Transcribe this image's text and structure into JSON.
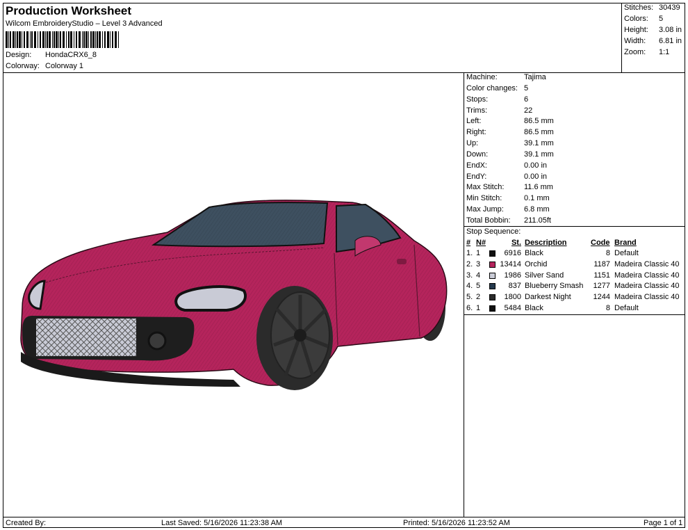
{
  "header": {
    "title": "Production Worksheet",
    "subtitle": "Wilcom EmbroideryStudio – Level 3 Advanced",
    "design_label": "Design:",
    "design_value": "HondaCRX6_8",
    "colorway_label": "Colorway:",
    "colorway_value": "Colorway 1"
  },
  "stats": [
    {
      "label": "Stitches:",
      "value": "30439"
    },
    {
      "label": "Colors:",
      "value": "5"
    },
    {
      "label": "Height:",
      "value": "3.08 in"
    },
    {
      "label": "Width:",
      "value": "6.81 in"
    },
    {
      "label": "Zoom:",
      "value": "1:1"
    }
  ],
  "machine_info": [
    {
      "label": "Machine:",
      "value": "Tajima"
    },
    {
      "label": "Color changes:",
      "value": "5"
    },
    {
      "label": "Stops:",
      "value": "6"
    },
    {
      "label": "Trims:",
      "value": "22"
    },
    {
      "label": "Left:",
      "value": "86.5 mm"
    },
    {
      "label": "Right:",
      "value": "86.5 mm"
    },
    {
      "label": "Up:",
      "value": "39.1 mm"
    },
    {
      "label": "Down:",
      "value": "39.1 mm"
    },
    {
      "label": "EndX:",
      "value": "0.00 in"
    },
    {
      "label": "EndY:",
      "value": "0.00 in"
    },
    {
      "label": "Max Stitch:",
      "value": "11.6 mm"
    },
    {
      "label": "Min Stitch:",
      "value": "0.1 mm"
    },
    {
      "label": "Max Jump:",
      "value": "6.8 mm"
    },
    {
      "label": "Total Bobbin:",
      "value": "211.05ft"
    }
  ],
  "stop_sequence": {
    "title": "Stop Sequence:",
    "headers": {
      "num": "#",
      "n": "N#",
      "st": "St.",
      "description": "Description",
      "code": "Code",
      "brand": "Brand"
    },
    "rows": [
      {
        "num": "1.",
        "n": "1",
        "color": "#111111",
        "st": "6916",
        "description": "Black",
        "code": "8",
        "brand": "Default"
      },
      {
        "num": "2.",
        "n": "3",
        "color": "#b5245c",
        "st": "13414",
        "description": "Orchid",
        "code": "1187",
        "brand": "Madeira Classic 40"
      },
      {
        "num": "3.",
        "n": "4",
        "color": "#c9cbd6",
        "st": "1986",
        "description": "Silver Sand",
        "code": "1151",
        "brand": "Madeira Classic 40"
      },
      {
        "num": "4.",
        "n": "5",
        "color": "#253a4e",
        "st": "837",
        "description": "Blueberry Smash",
        "code": "1277",
        "brand": "Madeira Classic 40"
      },
      {
        "num": "5.",
        "n": "2",
        "color": "#2b2b2b",
        "st": "1800",
        "description": "Darkest Night",
        "code": "1244",
        "brand": "Madeira Classic 40"
      },
      {
        "num": "6.",
        "n": "1",
        "color": "#111111",
        "st": "5484",
        "description": "Black",
        "code": "8",
        "brand": "Default"
      }
    ]
  },
  "footer": {
    "created_by": "Created By:",
    "last_saved": "Last Saved: 5/16/2026 11:23:38 AM",
    "printed": "Printed: 5/16/2026 11:23:52 AM",
    "page": "Page 1 of 1"
  },
  "colors": {
    "body": "#b5245c",
    "body_dark": "#7e1a41",
    "glass": "#3e5060",
    "silver": "#c9cbd6",
    "black": "#111111",
    "tire": "#2b2b2b"
  }
}
